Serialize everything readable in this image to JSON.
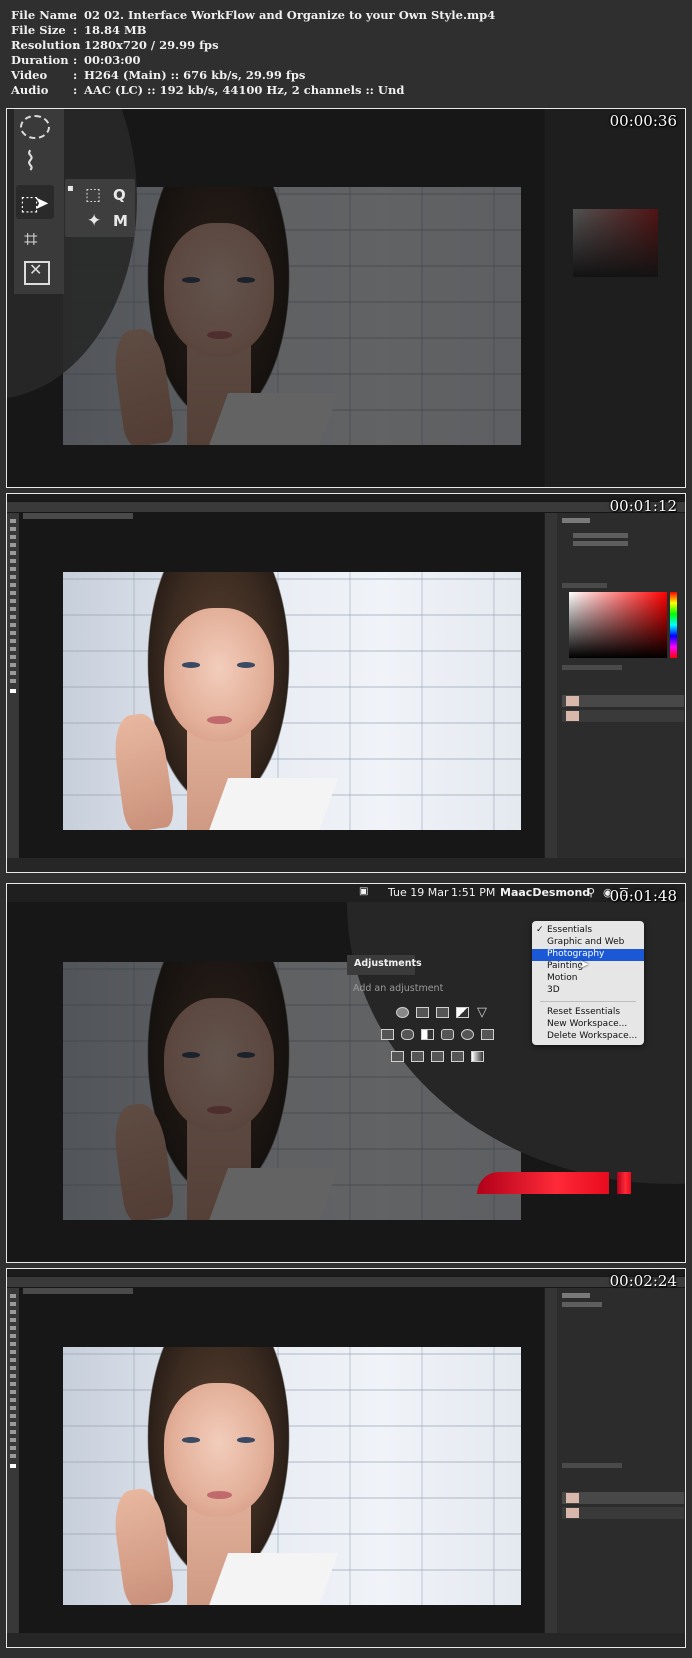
{
  "file_info": [
    {
      "key": "File Name",
      "value": "02 02. Interface WorkFlow and Organize to your Own Style.mp4"
    },
    {
      "key": "File Size",
      "value": "18.84 MB"
    },
    {
      "key": "Resolution",
      "value": "1280x720 / 29.99 fps"
    },
    {
      "key": "Duration",
      "value": "00:03:00"
    },
    {
      "key": "Video",
      "value": "H264 (Main) :: 676 kb/s, 29.99 fps"
    },
    {
      "key": "Audio",
      "value": "AAC (LC) :: 192 kb/s, 44100 Hz, 2 channels :: Und"
    }
  ],
  "separator": ":",
  "frames": [
    {
      "timestamp": "00:00:36"
    },
    {
      "timestamp": "00:01:12"
    },
    {
      "timestamp": "00:01:48"
    },
    {
      "timestamp": "00:02:24"
    }
  ],
  "frame1": {
    "popout_labels": [
      "Q",
      "M"
    ]
  },
  "frame3": {
    "menubar": {
      "date": "Tue 19 Mar",
      "time": "1:51 PM",
      "user": "MaacDesmond"
    },
    "panel_tab": "Adjustments",
    "panel_hint": "Add an adjustment",
    "workspace_menu": {
      "checked": "✓",
      "items": [
        "Essentials",
        "Graphic and Web",
        "Photography",
        "Painting",
        "Motion",
        "3D"
      ],
      "actions": [
        "Reset Essentials",
        "New Workspace...",
        "Delete Workspace..."
      ]
    }
  },
  "colors": {
    "menu_highlight": "#1a58d6",
    "accent_red": "#ff2a38"
  }
}
